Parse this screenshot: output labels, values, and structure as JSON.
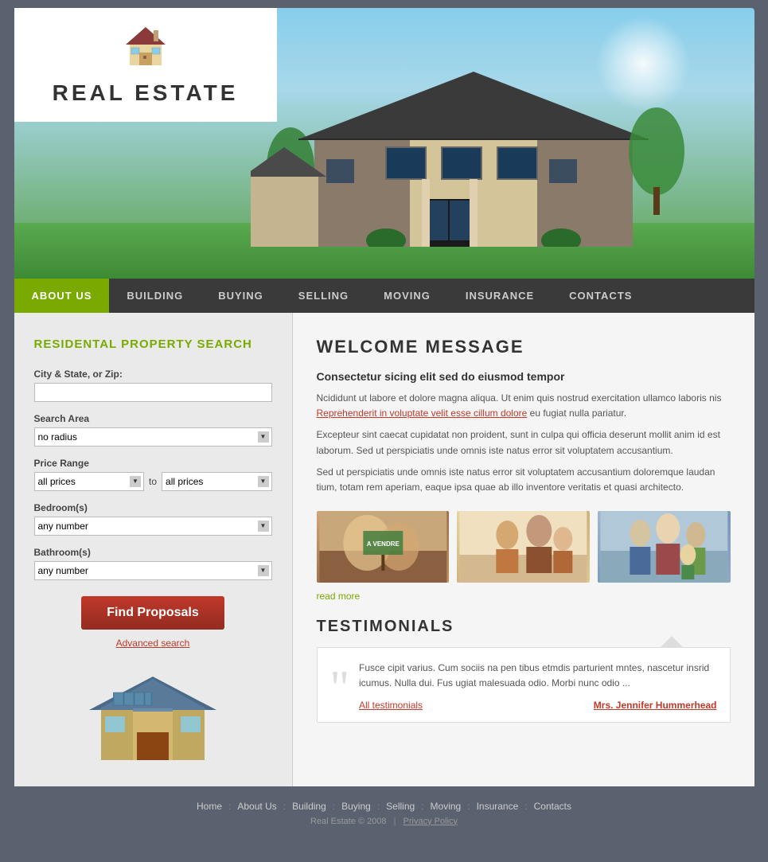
{
  "site": {
    "title": "REAL ESTATE"
  },
  "nav": {
    "items": [
      {
        "label": "ABOUT US",
        "active": true
      },
      {
        "label": "BUILDING",
        "active": false
      },
      {
        "label": "BUYING",
        "active": false
      },
      {
        "label": "SELLING",
        "active": false
      },
      {
        "label": "MOVING",
        "active": false
      },
      {
        "label": "INSURANCE",
        "active": false
      },
      {
        "label": "CONTACTS",
        "active": false
      }
    ]
  },
  "sidebar": {
    "title": "RESIDENTAL PROPERTY SEARCH",
    "city_label": "City & State, or Zip:",
    "city_placeholder": "",
    "search_area_label": "Search Area",
    "search_area_default": "no radius",
    "price_range_label": "Price Range",
    "price_to": "to",
    "price_from_default": "all prices",
    "price_to_default": "all prices",
    "bedrooms_label": "Bedroom(s)",
    "bedrooms_default": "any number",
    "bathrooms_label": "Bathroom(s)",
    "bathrooms_default": "any number",
    "find_btn": "Find Proposals",
    "advanced_link": "Advanced search"
  },
  "content": {
    "welcome_title": "WELCOME MESSAGE",
    "welcome_subtitle": "Consectetur sicing elit sed do eiusmod tempor",
    "welcome_p1": "Ncididunt ut labore et dolore magna aliqua. Ut enim quis nostrud  exercitation ullamco laboris nis",
    "welcome_link": "Reprehenderit in voluptate velit esse cillum dolore",
    "welcome_p1b": " eu fugiat nulla pariatur.",
    "welcome_p2": "Excepteur sint caecat cupidatat non proident, sunt in culpa qui officia deserunt mollit anim id est laborum. Sed ut perspiciatis unde omnis iste natus error sit voluptatem accusantium.",
    "welcome_p3": "Sed ut perspiciatis unde omnis iste natus error sit voluptatem accusantium doloremque laudan tium, totam rem aperiam, eaque ipsa quae ab illo inventore veritatis et quasi architecto.",
    "read_more": "read more",
    "testimonials_title": "TESTIMONIALS",
    "testimonial_text": "Fusce cipit varius. Cum sociis na pen tibus etmdis parturient mntes, nascetur insrid icumus. Nulla dui. Fus ugiat malesuada odio. Morbi nunc odio ...",
    "all_testimonials": "All testimonials",
    "testimonial_author": "Mrs. Jennifer Hummerhead"
  },
  "footer": {
    "links": [
      "Home",
      "About Us",
      "Building",
      "Buying",
      "Selling",
      "Moving",
      "Insurance",
      "Contacts"
    ],
    "copyright": "Real Estate © 2008",
    "privacy": "Privacy Policy"
  }
}
